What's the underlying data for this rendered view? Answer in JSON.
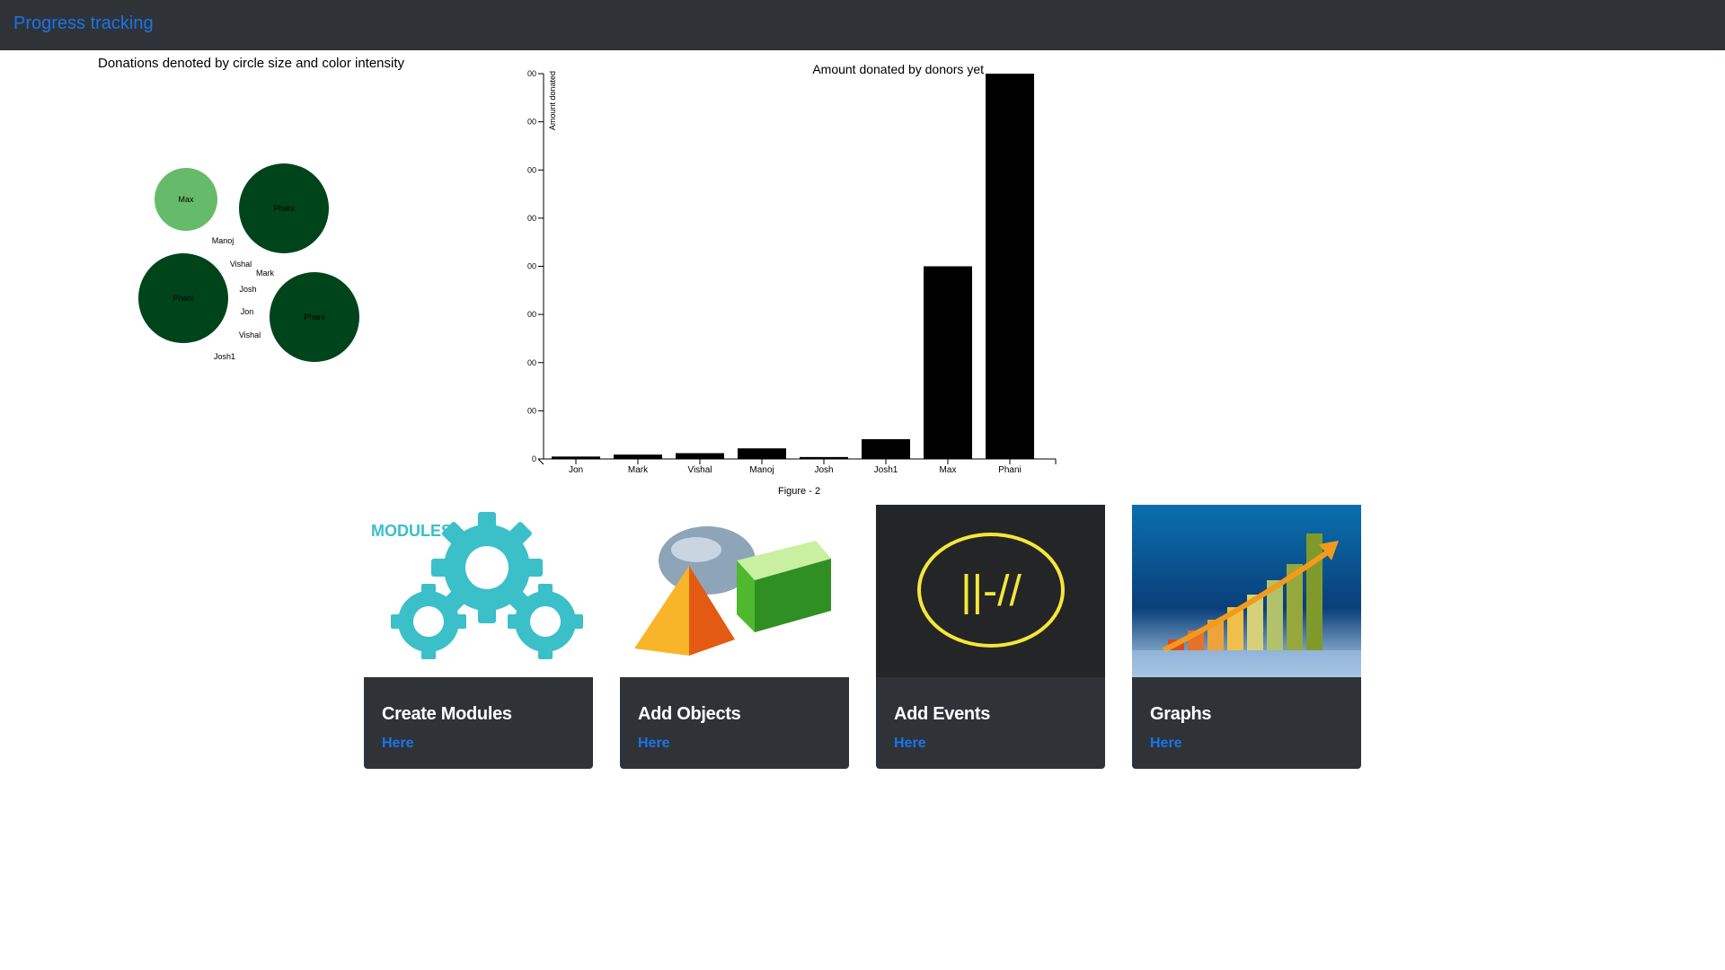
{
  "navbar": {
    "brand": "Progress tracking"
  },
  "bubble_chart": {
    "title": "Donations denoted by circle size and color intensity",
    "nodes": [
      {
        "label": "Max",
        "shade": "medium"
      },
      {
        "label": "Phani",
        "shade": "dark"
      },
      {
        "label": "Manoj",
        "shade": "none"
      },
      {
        "label": "Vishal",
        "shade": "none"
      },
      {
        "label": "Mark",
        "shade": "none"
      },
      {
        "label": "Phani",
        "shade": "dark"
      },
      {
        "label": "Josh",
        "shade": "none"
      },
      {
        "label": "Jon",
        "shade": "none"
      },
      {
        "label": "Phani",
        "shade": "dark"
      },
      {
        "label": "Vishal",
        "shade": "none"
      },
      {
        "label": "Josh1",
        "shade": "none"
      }
    ],
    "colors": {
      "medium": "#66bb6a",
      "dark": "#00441b"
    }
  },
  "chart_data": {
    "type": "bar",
    "title": "Amount donated by donors yet",
    "ylabel": "Amount donated",
    "xlabel": "",
    "caption": "Figure - 2",
    "categories": [
      "Jon",
      "Mark",
      "Vishal",
      "Manoj",
      "Josh",
      "Josh1",
      "Max",
      "Phani"
    ],
    "values": [
      5,
      9,
      12,
      22,
      4,
      41,
      400,
      800
    ],
    "ylim": [
      0,
      800
    ],
    "ytick_labels": [
      "0",
      "00",
      "00",
      "00",
      "00",
      "00",
      "00",
      "00",
      "00"
    ],
    "bar_color": "#000000"
  },
  "cards": [
    {
      "title": "Create Modules",
      "link": "Here",
      "image": "modules-gears-image",
      "image_text": "MODULES"
    },
    {
      "title": "Add Objects",
      "link": "Here",
      "image": "3d-shapes-image"
    },
    {
      "title": "Add Events",
      "link": "Here",
      "image": "events-logo-image",
      "image_text": "||-//"
    },
    {
      "title": "Graphs",
      "link": "Here",
      "image": "growth-graph-image"
    }
  ]
}
